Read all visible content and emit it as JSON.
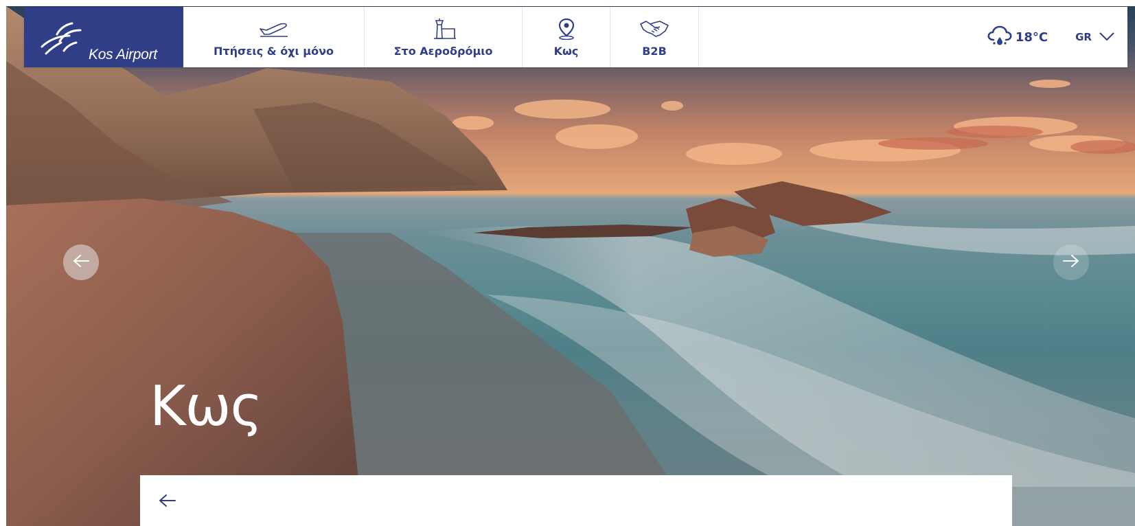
{
  "header": {
    "logo_text": "Kos Airport",
    "nav": [
      {
        "label": "Πτήσεις & όχι μόνο",
        "icon": "airplane-icon"
      },
      {
        "label": "Στο Αεροδρόμιο",
        "icon": "control-tower-icon"
      },
      {
        "label": "Κως",
        "icon": "map-pin-icon"
      },
      {
        "label": "B2B",
        "icon": "handshake-icon"
      }
    ],
    "weather": {
      "temperature": "18°C",
      "icon": "rain-cloud-icon"
    },
    "language": {
      "label": "GR",
      "icon": "chevron-down-icon"
    }
  },
  "hero": {
    "title": "Κως",
    "prev_icon": "arrow-left-icon",
    "next_icon": "arrow-right-icon"
  },
  "panel": {
    "back_icon": "arrow-left-icon"
  },
  "colors": {
    "brand": "#2f3e86",
    "nav_text": "#2f3e86",
    "background": "#ffffff"
  }
}
